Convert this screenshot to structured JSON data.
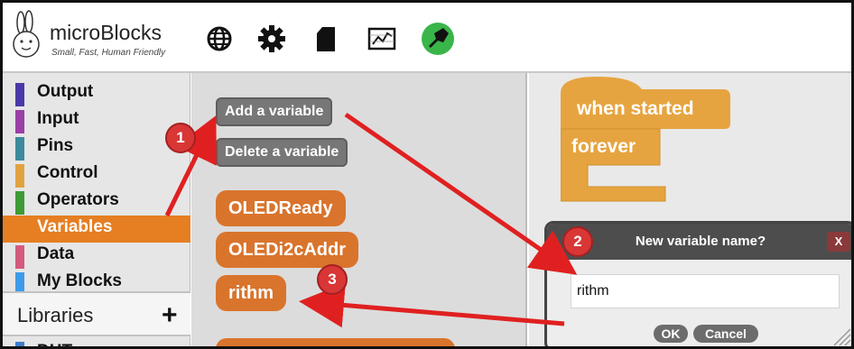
{
  "header": {
    "app_title": "microBlocks",
    "tagline": "Small, Fast, Human Friendly",
    "toolbar_icons": [
      "globe-icon",
      "gear-icon",
      "sd-card-icon",
      "graph-icon",
      "usb-connection-icon"
    ],
    "connection_color": "#39b54a"
  },
  "categories": [
    {
      "label": "Output",
      "color": "#4a3aa8"
    },
    {
      "label": "Input",
      "color": "#9b3fa6"
    },
    {
      "label": "Pins",
      "color": "#3c8a9c"
    },
    {
      "label": "Control",
      "color": "#e0a340"
    },
    {
      "label": "Operators",
      "color": "#3f9b35"
    },
    {
      "label": "Variables",
      "color": "#e67e22"
    },
    {
      "label": "Data",
      "color": "#d45b7d"
    },
    {
      "label": "My Blocks",
      "color": "#3d9ae8"
    }
  ],
  "selected_category": "Variables",
  "libraries": {
    "label": "Libraries",
    "add_glyph": "+"
  },
  "library_items": [
    {
      "label": "DHT"
    }
  ],
  "variable_buttons": {
    "add": "Add a variable",
    "delete": "Delete a variable"
  },
  "variables": [
    "OLEDReady",
    "OLEDi2cAddr",
    "rithm"
  ],
  "script": {
    "hat_label": "when started",
    "loop_label": "forever",
    "block_color": "#e6a440"
  },
  "dialog": {
    "title": "New variable name?",
    "close_label": "X",
    "input_value": "rithm",
    "ok_label": "OK",
    "cancel_label": "Cancel"
  },
  "annotations": {
    "step1": "1",
    "step2": "2",
    "step3": "3",
    "color": "#e02020"
  }
}
